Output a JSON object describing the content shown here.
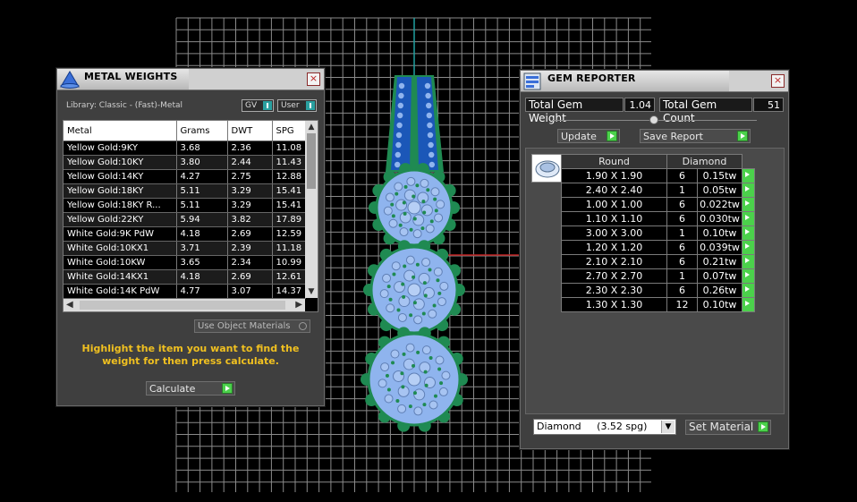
{
  "metal_weights": {
    "title": "METAL WEIGHTS",
    "close": "×",
    "library": "Library: Classic - (Fast)-Metal",
    "gv_label": "GV",
    "user_label": "User",
    "columns": [
      "Metal",
      "Grams",
      "DWT",
      "SPG"
    ],
    "rows": [
      [
        "Yellow Gold:9KY",
        "3.68",
        "2.36",
        "11.08"
      ],
      [
        "Yellow Gold:10KY",
        "3.80",
        "2.44",
        "11.43"
      ],
      [
        "Yellow Gold:14KY",
        "4.27",
        "2.75",
        "12.88"
      ],
      [
        "Yellow Gold:18KY",
        "5.11",
        "3.29",
        "15.41"
      ],
      [
        "Yellow Gold:18KY R...",
        "5.11",
        "3.29",
        "15.41"
      ],
      [
        "Yellow Gold:22KY",
        "5.94",
        "3.82",
        "17.89"
      ],
      [
        "White Gold:9K PdW",
        "4.18",
        "2.69",
        "12.59"
      ],
      [
        "White Gold:10KX1",
        "3.71",
        "2.39",
        "11.18"
      ],
      [
        "White Gold:10KW",
        "3.65",
        "2.34",
        "10.99"
      ],
      [
        "White Gold:14KX1",
        "4.18",
        "2.69",
        "12.61"
      ],
      [
        "White Gold:14K PdW",
        "4.77",
        "3.07",
        "14.37"
      ]
    ],
    "use_object_materials": "Use Object Materials",
    "instruction": "Highlight the item you want to find the weight for then press calculate.",
    "calculate_label": "Calculate"
  },
  "gem_reporter": {
    "title": "GEM REPORTER",
    "close": "×",
    "total_weight_label": "Total Gem Weight",
    "total_weight_value": "1.04",
    "total_count_label": "Total Gem Count",
    "total_count_value": "51",
    "update_label": "Update",
    "save_report_label": "Save Report",
    "table_headers": [
      "Round",
      "Diamond"
    ],
    "rows": [
      [
        "1.90 X 1.90",
        "6",
        "0.15tw"
      ],
      [
        "2.40 X 2.40",
        "1",
        "0.05tw"
      ],
      [
        "1.00 X 1.00",
        "6",
        "0.022tw"
      ],
      [
        "1.10 X 1.10",
        "6",
        "0.030tw"
      ],
      [
        "3.00 X 3.00",
        "1",
        "0.10tw"
      ],
      [
        "1.20 X 1.20",
        "6",
        "0.039tw"
      ],
      [
        "2.10 X 2.10",
        "6",
        "0.21tw"
      ],
      [
        "2.70 X 2.70",
        "1",
        "0.07tw"
      ],
      [
        "2.30 X 2.30",
        "6",
        "0.26tw"
      ],
      [
        "1.30 X 1.30",
        "12",
        "0.10tw"
      ]
    ],
    "material_value": "Diamond     (3.52 spg)",
    "set_material_label": "Set Material"
  },
  "colors": {
    "grid": "#8a8a8a",
    "gem_fill": "#8fb4ee",
    "metal_green": "#1f8a52",
    "bar_blue": "#1b57b8",
    "accent_yellow": "#f0c020",
    "axis_red": "#c02020",
    "axis_teal": "#20a0a0"
  }
}
